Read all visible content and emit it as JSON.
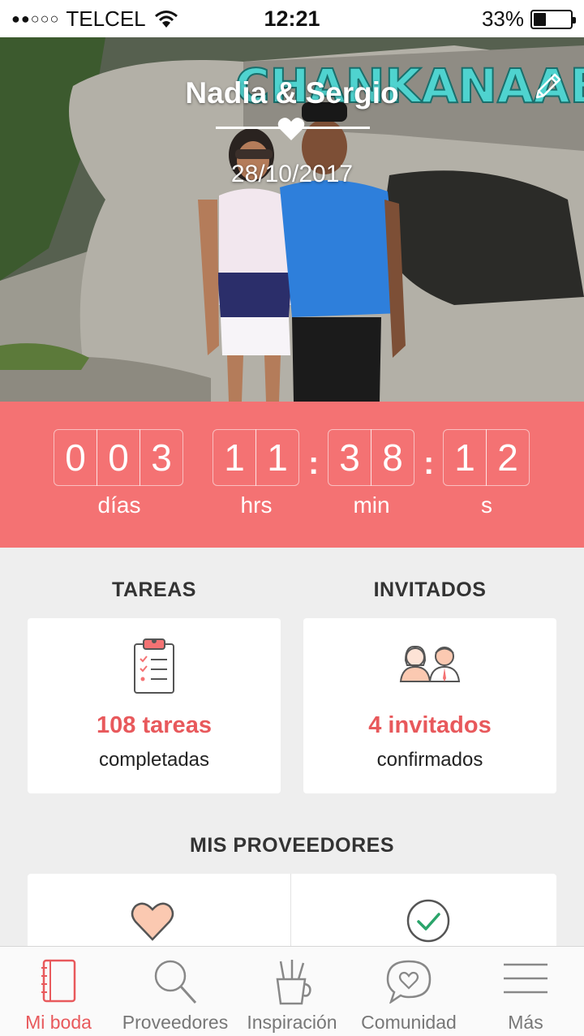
{
  "status_bar": {
    "signal": "●●○○○",
    "carrier": "TELCEL",
    "time": "12:21",
    "battery_percent": "33%",
    "battery_level": 0.33
  },
  "hero": {
    "couple_names": "Nadia & Sergio",
    "wedding_date": "28/10/2017",
    "edit_icon": "pencil-icon",
    "divider_icon": "heart-icon"
  },
  "countdown": {
    "days_digits": [
      "0",
      "0",
      "3"
    ],
    "hours_digits": [
      "1",
      "1"
    ],
    "minutes_digits": [
      "3",
      "8"
    ],
    "seconds_digits": [
      "1",
      "2"
    ],
    "separator": ":",
    "labels": {
      "days": "días",
      "hours": "hrs",
      "minutes": "min",
      "seconds": "s"
    }
  },
  "tareas": {
    "title": "TAREAS",
    "value": "108 tareas",
    "subtitle": "completadas",
    "icon": "clipboard-checklist-icon"
  },
  "invitados": {
    "title": "INVITADOS",
    "value": "4 invitados",
    "subtitle": "confirmados",
    "icon": "couple-icon"
  },
  "proveedores": {
    "title": "MIS PROVEEDORES",
    "icons": [
      "heart-icon",
      "check-circle-icon"
    ]
  },
  "tab_bar": {
    "active": "Mi boda",
    "tabs": [
      {
        "label": "Mi boda",
        "icon": "notebook-icon"
      },
      {
        "label": "Proveedores",
        "icon": "search-icon"
      },
      {
        "label": "Inspiración",
        "icon": "pencil-cup-icon"
      },
      {
        "label": "Comunidad",
        "icon": "chat-heart-icon"
      },
      {
        "label": "Más",
        "icon": "menu-icon"
      }
    ]
  },
  "colors": {
    "accent": "#f47273",
    "accent_text": "#e8595c",
    "background": "#eeeeee"
  }
}
